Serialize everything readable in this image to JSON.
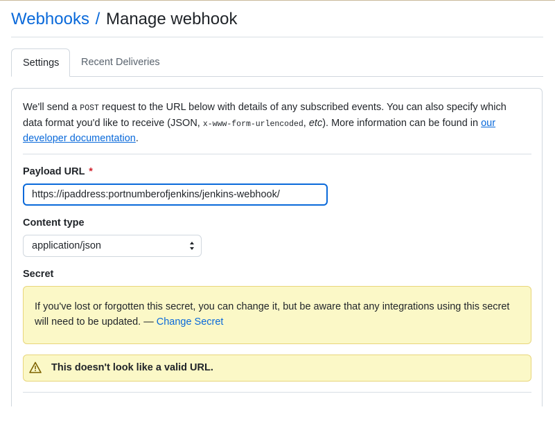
{
  "header": {
    "breadcrumb": "Webhooks",
    "separator": "/",
    "title": "Manage webhook"
  },
  "tabs": [
    {
      "label": "Settings",
      "active": true
    },
    {
      "label": "Recent Deliveries",
      "active": false
    }
  ],
  "intro": {
    "text1": "We'll send a ",
    "code1": "POST",
    "text2": " request to the URL below with details of any subscribed events. You can also specify which data format you'd like to receive (JSON, ",
    "code2": "x-www-form-urlencoded",
    "text3": ", ",
    "em": "etc",
    "text4": "). More information can be found in ",
    "link": "our developer documentation",
    "text5": "."
  },
  "payload_url": {
    "label": "Payload URL",
    "required_mark": "*",
    "value": "https://ipaddress:portnumberofjenkins/jenkins-webhook/"
  },
  "content_type": {
    "label": "Content type",
    "selected": "application/json"
  },
  "secret": {
    "label": "Secret",
    "notice_text": "If you've lost or forgotten this secret, you can change it, but be aware that any integrations using this secret will need to be updated. — ",
    "change_link": "Change Secret"
  },
  "warning": {
    "icon": "alert-icon",
    "text": "This doesn't look like a valid URL."
  },
  "colors": {
    "link": "#0969da",
    "required": "#d1242f",
    "notice_bg": "#fbf8c7",
    "focus_border": "#0969da"
  }
}
